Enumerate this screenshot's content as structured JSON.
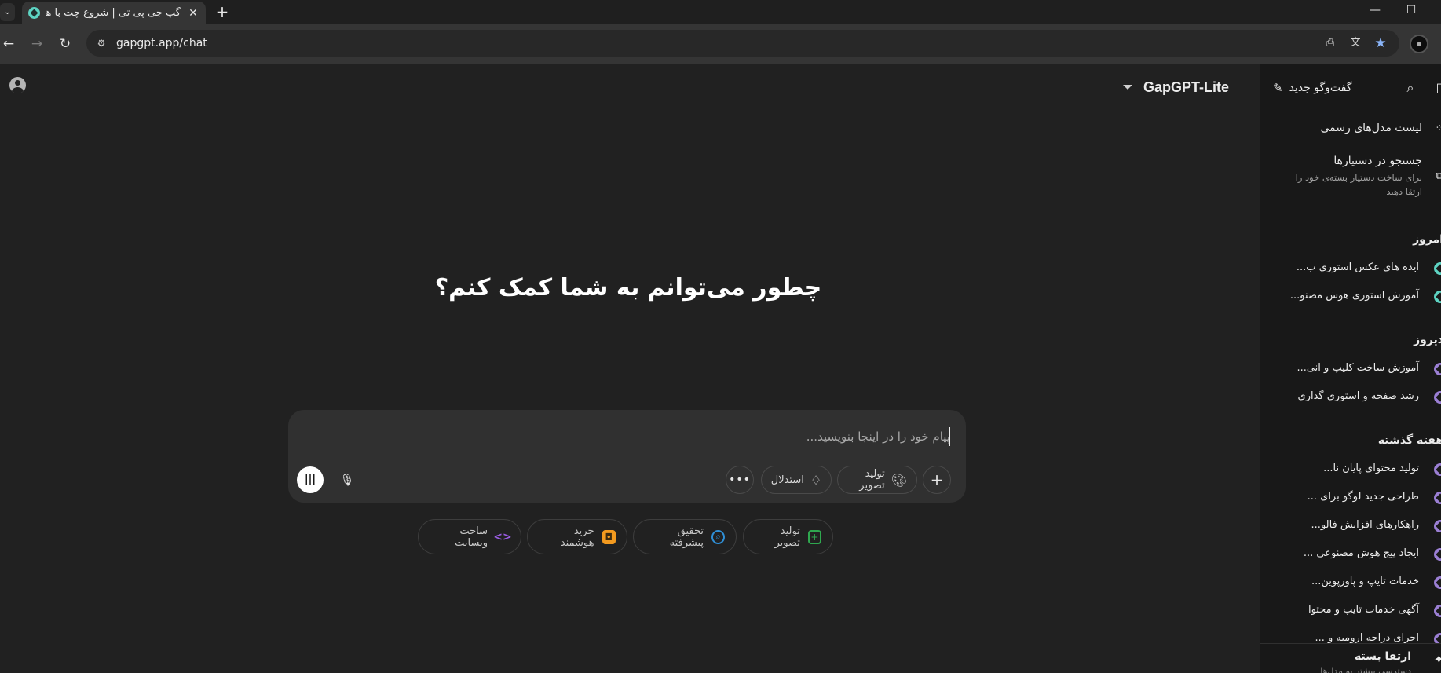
{
  "browser": {
    "tab_title": "گپ جی پی تی | شروع چت با هوش مصنوعی",
    "url": "gapgpt.app/chat",
    "icons": [
      "tab-list-icon",
      "new-tab-icon",
      "minimize-icon",
      "maximize-icon",
      "back-icon",
      "forward-icon",
      "reload-icon",
      "site-info-icon",
      "install-app-icon",
      "translate-icon",
      "bookmark-star-icon",
      "profile-avatar"
    ]
  },
  "header": {
    "model_name": "GapGPT-Lite"
  },
  "main": {
    "heading": "چطور می‌توانم به شما کمک کنم؟",
    "composer": {
      "placeholder": "پیام خود را در اینجا بنویسید...",
      "tools": [
        {
          "label": "تولید تصویر",
          "icon": "palette-icon"
        },
        {
          "label": "استدلال",
          "icon": "lightbulb-icon"
        }
      ]
    },
    "suggestions": [
      {
        "label": "تولید تصویر",
        "icon": "image-add-icon",
        "color": "#2fa84f"
      },
      {
        "label": "تحقیق پیشرفته",
        "icon": "research-icon",
        "color": "#2f8fd6"
      },
      {
        "label": "خرید هوشمند",
        "icon": "shopping-bag-icon",
        "color": "#f39a1f"
      },
      {
        "label": "ساخت وبسایت",
        "icon": "code-icon",
        "color": "#9b5de5"
      }
    ]
  },
  "sidebar": {
    "new_chat": "گفت‌وگو جدید",
    "models_list": "لیست مدل‌های رسمی",
    "assistants_search": "جستجو در دستیارها",
    "assistants_sub": "برای ساخت دستیار بسته‌ی خود را ارتقا دهید",
    "sections": [
      {
        "title": "امروز",
        "chats": [
          "ایده های عکس استوری ب...",
          "آموزش استوری هوش مصنو..."
        ]
      },
      {
        "title": "دیروز",
        "chats": [
          "آموزش ساخت کلیپ و انی...",
          "رشد صفحه و استوری گذاری"
        ]
      },
      {
        "title": "هفته گذشته",
        "chats": [
          "تولید محتوای پایان نا...",
          "طراحی جدید لوگو برای ...",
          "راهکارهای افزایش فالو...",
          "ایجاد پیج هوش مصنوعی ...",
          "خدمات تایپ و پاورپوین...",
          "آگهی خدمات تایپ و محتوا",
          "اجرای دراجه ارومیه و ..."
        ]
      }
    ],
    "upgrade_title": "ارتقا بسته",
    "upgrade_sub": "دسترسی بیشتر به مدل‌ها"
  },
  "colors": {
    "background": "#212121",
    "sidebar": "#181818",
    "composer": "#303030",
    "chat_icon_teal": "#5dd3c2",
    "chat_icon_purple": "#9b7fd4"
  }
}
